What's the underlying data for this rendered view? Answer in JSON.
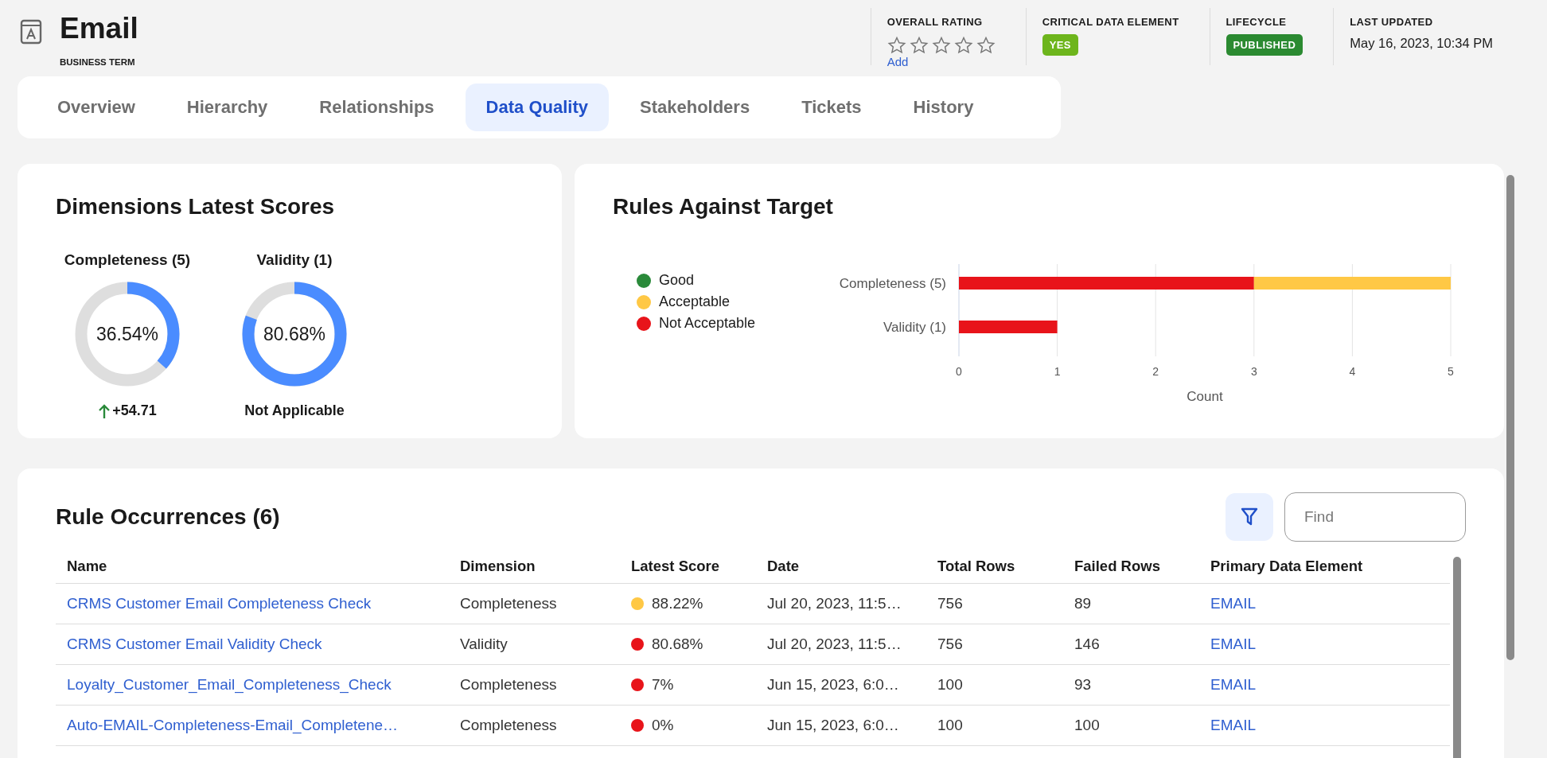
{
  "header": {
    "title": "Email",
    "subtitle": "BUSINESS TERM",
    "meta": [
      {
        "kind": "rating",
        "label": "OVERALL RATING",
        "stars": 0,
        "link": "Add"
      },
      {
        "kind": "badge",
        "label": "CRITICAL DATA ELEMENT",
        "value": "YES",
        "color": "#6db51c"
      },
      {
        "kind": "badge",
        "label": "LIFECYCLE",
        "value": "PUBLISHED",
        "color": "#2b8a31"
      },
      {
        "kind": "text",
        "label": "LAST UPDATED",
        "value": "May 16, 2023, 10:34 PM"
      }
    ]
  },
  "tabs": [
    {
      "label": "Overview",
      "selected": false
    },
    {
      "label": "Hierarchy",
      "selected": false
    },
    {
      "label": "Relationships",
      "selected": false
    },
    {
      "label": "Data Quality",
      "selected": true
    },
    {
      "label": "Stakeholders",
      "selected": false
    },
    {
      "label": "Tickets",
      "selected": false
    },
    {
      "label": "History",
      "selected": false
    }
  ],
  "dimensions": {
    "title": "Dimensions Latest Scores",
    "items": [
      {
        "kind": "trend-up",
        "label": "Completeness (5)",
        "value": "36.54%",
        "footer": "+54.71"
      },
      {
        "kind": "plain",
        "label": "Validity (1)",
        "value": "80.68%",
        "footer": "Not Applicable"
      }
    ]
  },
  "rules": {
    "title": "Rules Against Target",
    "chart_data": {
      "type": "bar",
      "orientation": "horizontal",
      "stacked": true,
      "grid": true,
      "legend": "left",
      "xlabel": "Count",
      "categories": [
        "Completeness (5)",
        "Validity (1)"
      ],
      "series": [
        {
          "name": "Good",
          "color": "#2a8a3a",
          "values": [
            0,
            0
          ]
        },
        {
          "name": "Acceptable",
          "color": "#ffc845",
          "values": [
            2,
            0
          ]
        },
        {
          "name": "Not Acceptable",
          "color": "#e8141a",
          "values": [
            3,
            1
          ]
        }
      ],
      "xlim": [
        0,
        5
      ],
      "xticks": [
        0,
        1,
        2,
        3,
        4,
        5
      ]
    }
  },
  "occurrences": {
    "title": "Rule Occurrences (6)",
    "search": {
      "placeholder": "Find"
    },
    "columns": [
      "Name",
      "Dimension",
      "Latest Score",
      "Date",
      "Total Rows",
      "Failed Rows",
      "Primary Data Element"
    ],
    "rows": [
      {
        "name": "CRMS Customer Email Completeness Check",
        "dimension": "Completeness",
        "score": "88.22%",
        "color": "#ffc845",
        "date": "Jul 20, 2023, 11:5…",
        "total_rows": "756",
        "failed_rows": "89",
        "element": "EMAIL"
      },
      {
        "name": "CRMS Customer Email Validity Check",
        "dimension": "Validity",
        "score": "80.68%",
        "color": "#e8141a",
        "date": "Jul 20, 2023, 11:5…",
        "total_rows": "756",
        "failed_rows": "146",
        "element": "EMAIL"
      },
      {
        "name": "Loyalty_Customer_Email_Completeness_Check",
        "dimension": "Completeness",
        "score": "7%",
        "color": "#e8141a",
        "date": "Jun 15, 2023, 6:0…",
        "total_rows": "100",
        "failed_rows": "93",
        "element": "EMAIL"
      },
      {
        "name": "Auto-EMAIL-Completeness-Email_Completene…",
        "dimension": "Completeness",
        "score": "0%",
        "color": "#e8141a",
        "date": "Jun 15, 2023, 6:0…",
        "total_rows": "100",
        "failed_rows": "100",
        "element": "EMAIL"
      }
    ]
  }
}
